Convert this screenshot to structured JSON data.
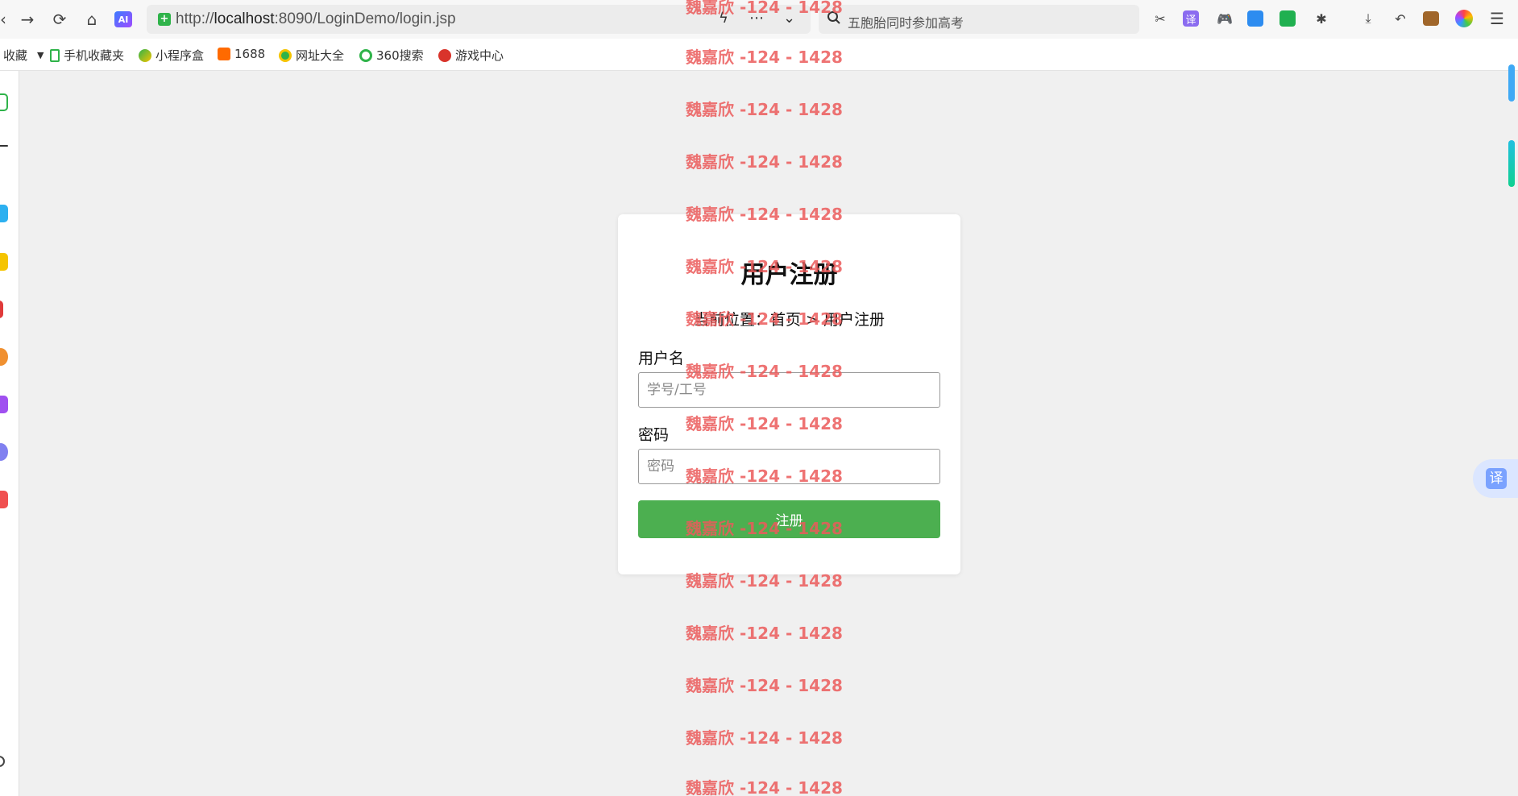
{
  "browser": {
    "url_prefix": "http://",
    "url_host": "localhost",
    "url_rest": ":8090/LoginDemo/login.jsp",
    "ai_label": "AI",
    "search_placeholder": "五胞胎同时参加高考",
    "translate_label": "译"
  },
  "bookmarks": [
    {
      "label": "收藏",
      "icon": "star-icon"
    },
    {
      "label": "手机收藏夹",
      "icon": "phone-icon"
    },
    {
      "label": "小程序盒",
      "icon": "miniapp-icon"
    },
    {
      "label": "1688",
      "icon": "1688-icon"
    },
    {
      "label": "网址大全",
      "icon": "globe-icon"
    },
    {
      "label": "360搜索",
      "icon": "360-search-icon"
    },
    {
      "label": "游戏中心",
      "icon": "game-center-icon"
    }
  ],
  "form": {
    "title": "用户注册",
    "breadcrumb": "当前位置：首页 > 用户注册",
    "username_label": "用户名",
    "username_placeholder": "学号/工号",
    "password_label": "密码",
    "password_placeholder": "密码",
    "submit_label": "注册"
  },
  "watermark": "魏嘉欣 -124 - 1428",
  "colors": {
    "submit": "#4caf50",
    "watermark": "#eb5a5a",
    "page_bg": "#f0f0f0"
  },
  "floating": {
    "translate_label": "译"
  }
}
